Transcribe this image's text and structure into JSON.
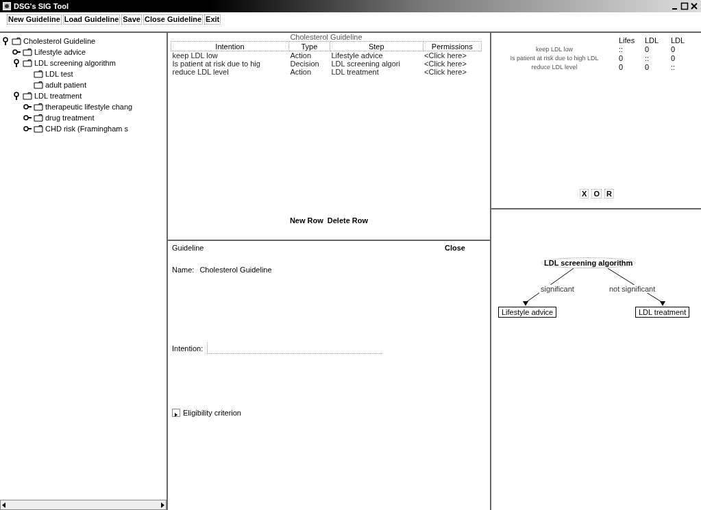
{
  "window": {
    "title": "DSG's SIG Tool"
  },
  "toolbar": [
    "New Guideline",
    "Load Guideline",
    "Save",
    "Close Guideline",
    "Exit"
  ],
  "tree": [
    {
      "label": "Cholesterol Guideline",
      "expanded": true,
      "children": [
        {
          "label": "Lifestyle advice",
          "expanded": false
        },
        {
          "label": "LDL screening algorithm",
          "expanded": true,
          "children": [
            {
              "label": "LDL test"
            },
            {
              "label": "adult patient"
            }
          ]
        },
        {
          "label": "LDL treatment",
          "expanded": true,
          "children": [
            {
              "label": "therapeutic lifestyle chang",
              "expanded": false
            },
            {
              "label": "drug treatment",
              "expanded": false
            },
            {
              "label": "CHD risk (Framingham s",
              "expanded": false
            }
          ]
        }
      ]
    }
  ],
  "table": {
    "title": "Cholesterol Guideline",
    "columns": [
      "Intention",
      "Type",
      "Step",
      "Permissions"
    ],
    "rows": [
      [
        "keep LDL low",
        "Action",
        "Lifestyle advice",
        "<Click here>"
      ],
      [
        "Is patient at risk due to hig",
        "Decision",
        "LDL screening algori",
        "<Click here>"
      ],
      [
        "reduce LDL level",
        "Action",
        "LDL treatment",
        "<Click here>"
      ]
    ]
  },
  "row_buttons": [
    "New Row",
    "Delete Row"
  ],
  "detail": {
    "title": "Guideline",
    "close": "Close",
    "name_label": "Name:",
    "name_value": "Cholesterol Guideline",
    "intention_label": "Intention:",
    "eligibility": "Eligibility criterion"
  },
  "matrix": {
    "columns": [
      "Lifes",
      "LDL",
      "LDL"
    ],
    "rows": [
      {
        "label": "keep LDL low",
        "cells": [
          "::",
          "0",
          "0"
        ]
      },
      {
        "label": "Is patient at risk due to high LDL",
        "cells": [
          "0",
          "::",
          "0"
        ]
      },
      {
        "label": "reduce LDL level",
        "cells": [
          "0",
          "0",
          "::"
        ]
      }
    ]
  },
  "logic_buttons": [
    "X",
    "O",
    "R"
  ],
  "graph": {
    "root": "LDL screening algorithm",
    "edge_labels": [
      "significant",
      "not significant"
    ],
    "nodes": [
      "Lifestyle advice",
      "LDL treatment"
    ]
  }
}
